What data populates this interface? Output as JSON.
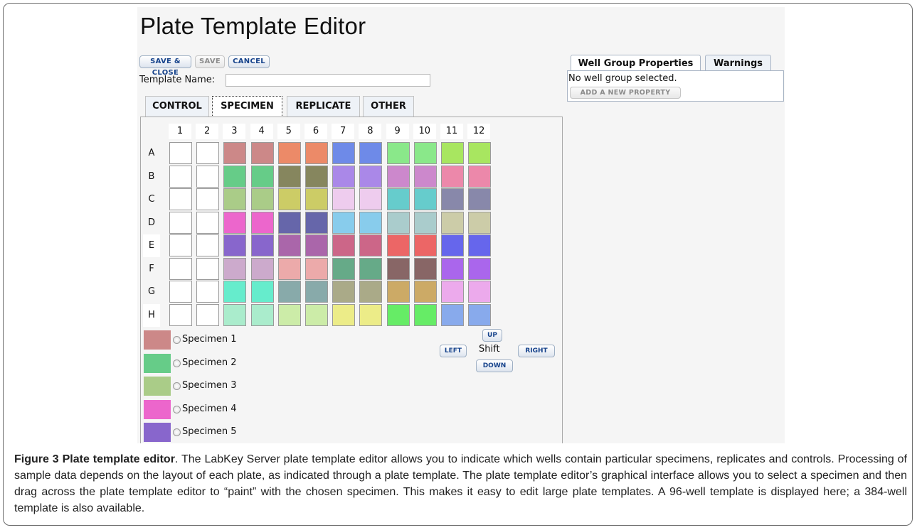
{
  "editor": {
    "title": "Plate Template Editor",
    "buttons": {
      "save_close": "SAVE & CLOSE",
      "save": "SAVE",
      "cancel": "CANCEL"
    },
    "template_name_label": "Template Name:",
    "template_name_value": "",
    "tabs": [
      "CONTROL",
      "SPECIMEN",
      "REPLICATE",
      "OTHER"
    ],
    "active_tab": "SPECIMEN",
    "plate": {
      "columns": [
        "1",
        "2",
        "3",
        "4",
        "5",
        "6",
        "7",
        "8",
        "9",
        "10",
        "11",
        "12"
      ],
      "rows": [
        "A",
        "B",
        "C",
        "D",
        "E",
        "F",
        "G",
        "H"
      ],
      "well_colors": [
        [
          "#ffffff",
          "#ffffff",
          "#cc8888",
          "#cc8888",
          "#ec8a68",
          "#ec8a68",
          "#6e8ae8",
          "#6e8ae8",
          "#8ae88a",
          "#8ae88a",
          "#a8e660",
          "#a8e660"
        ],
        [
          "#ffffff",
          "#ffffff",
          "#66cc88",
          "#66cc88",
          "#86865e",
          "#86865e",
          "#aa88e8",
          "#aa88e8",
          "#cc88cc",
          "#cc88cc",
          "#ec88aa",
          "#ec88aa"
        ],
        [
          "#ffffff",
          "#ffffff",
          "#aacc88",
          "#aacc88",
          "#cccc66",
          "#cccc66",
          "#eeccee",
          "#eeccee",
          "#66cccc",
          "#66cccc",
          "#8888aa",
          "#8888aa"
        ],
        [
          "#ffffff",
          "#ffffff",
          "#ec66cc",
          "#ec66cc",
          "#6666aa",
          "#6666aa",
          "#88ccec",
          "#88ccec",
          "#aacccc",
          "#aacccc",
          "#cccca8",
          "#cccca8"
        ],
        [
          "#ffffff",
          "#ffffff",
          "#8866cc",
          "#8866cc",
          "#aa66aa",
          "#aa66aa",
          "#cc6688",
          "#cc6688",
          "#ec6666",
          "#ec6666",
          "#6666ec",
          "#6666ec"
        ],
        [
          "#ffffff",
          "#ffffff",
          "#ccaacc",
          "#ccaacc",
          "#ecaaaa",
          "#ecaaaa",
          "#66aa88",
          "#66aa88",
          "#886666",
          "#886666",
          "#aa66ec",
          "#aa66ec"
        ],
        [
          "#ffffff",
          "#ffffff",
          "#66eccc",
          "#66eccc",
          "#88aaaa",
          "#88aaaa",
          "#aaaa88",
          "#aaaa88",
          "#ccaa66",
          "#ccaa66",
          "#ecaaec",
          "#ecaaec"
        ],
        [
          "#ffffff",
          "#ffffff",
          "#aaeccc",
          "#aaeccc",
          "#cceca8",
          "#cceca8",
          "#ecec88",
          "#ecec88",
          "#66ec66",
          "#66ec66",
          "#88aaec",
          "#88aaec"
        ]
      ]
    },
    "specimens": [
      {
        "label": "Specimen 1",
        "color": "#cc8888"
      },
      {
        "label": "Specimen 2",
        "color": "#66cc88"
      },
      {
        "label": "Specimen 3",
        "color": "#aacc88"
      },
      {
        "label": "Specimen 4",
        "color": "#ec66cc"
      },
      {
        "label": "Specimen 5",
        "color": "#8866cc"
      }
    ],
    "shift": {
      "label": "Shift",
      "up": "UP",
      "down": "DOWN",
      "left": "LEFT",
      "right": "RIGHT"
    },
    "right_tabs": [
      "Well Group Properties",
      "Warnings"
    ],
    "properties": {
      "empty_text": "No well group selected.",
      "add_button": "ADD A NEW PROPERTY"
    }
  },
  "caption": {
    "bold": "Figure 3 Plate template editor",
    "text": ". The LabKey Server plate template editor allows you to indicate which wells contain particular specimens, replicates and controls. Processing of sample data depends on the layout of each plate, as indicated through a plate template. The plate template editor’s graphical interface allows you to select a specimen and then drag across the plate template editor to “paint” with the chosen specimen. This makes it easy to edit large plate templates. A 96-well template is displayed here; a 384-well template is also available."
  }
}
